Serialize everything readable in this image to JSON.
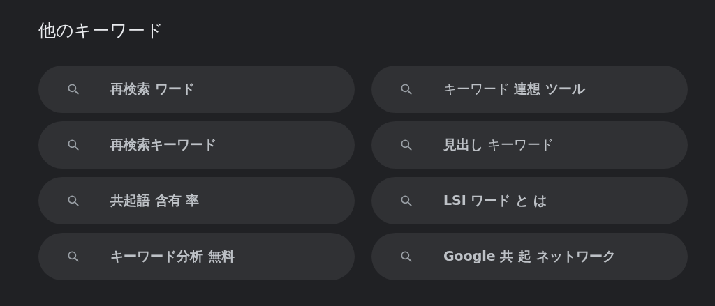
{
  "title": "他のキーワード",
  "suggestions": [
    {
      "text": "再検索 ワード",
      "bold": true
    },
    {
      "text": "キーワード **連想 ツール**",
      "bold": false
    },
    {
      "text": "再検索キーワード",
      "bold": true
    },
    {
      "text": "**見出し** キーワード",
      "bold": false
    },
    {
      "text": "共起語 含有 率",
      "bold": true
    },
    {
      "text": "LSI ワード と は",
      "bold": true
    },
    {
      "text": "キーワード分析 無料",
      "bold": true
    },
    {
      "text": "Google 共 起 ネットワーク",
      "bold": true
    }
  ]
}
